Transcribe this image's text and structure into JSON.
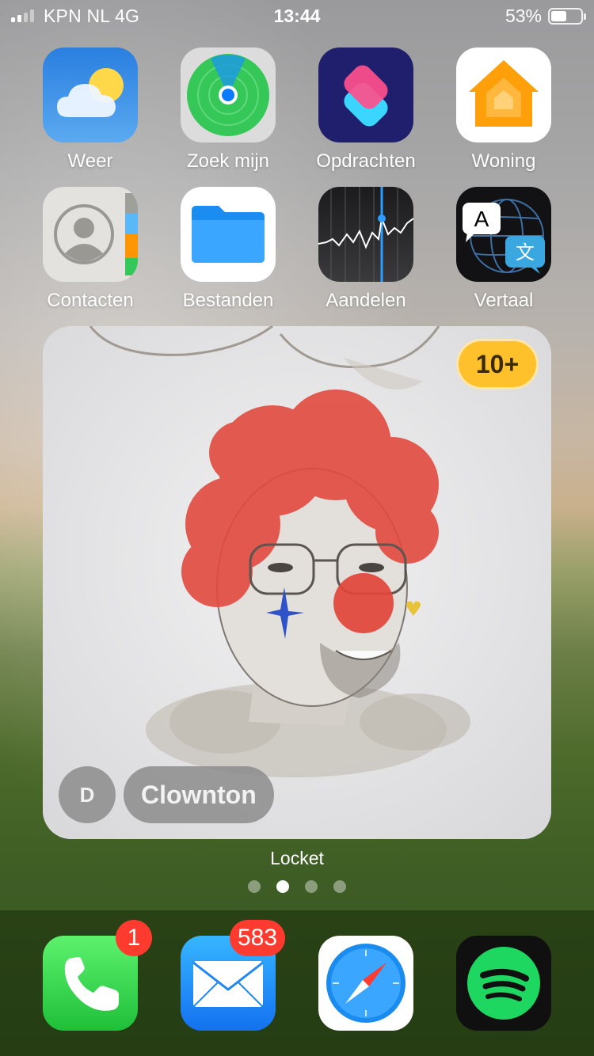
{
  "status_bar": {
    "carrier": "KPN NL   4G",
    "time": "13:44",
    "battery": "53%",
    "battery_level": 0.53,
    "signal_bars": 2
  },
  "apps": [
    {
      "label": "Weer",
      "icon": "weather-icon"
    },
    {
      "label": "Zoek mijn",
      "icon": "find-my-icon"
    },
    {
      "label": "Opdrachten",
      "icon": "shortcuts-icon"
    },
    {
      "label": "Woning",
      "icon": "home-icon"
    },
    {
      "label": "Contacten",
      "icon": "contacts-icon"
    },
    {
      "label": "Bestanden",
      "icon": "files-icon"
    },
    {
      "label": "Aandelen",
      "icon": "stocks-icon"
    },
    {
      "label": "Vertaal",
      "icon": "translate-icon"
    }
  ],
  "widget": {
    "label": "Locket",
    "count_badge": "10+",
    "sender_initial": "D",
    "caption": "Clownton",
    "photo": "clown-portrait-sketch"
  },
  "page_dots": {
    "count": 4,
    "active": 1
  },
  "dock": [
    {
      "app": "Phone",
      "icon": "phone-icon",
      "badge": "1"
    },
    {
      "app": "Mail",
      "icon": "mail-icon",
      "badge": "583"
    },
    {
      "app": "Safari",
      "icon": "safari-icon",
      "badge": ""
    },
    {
      "app": "Spotify",
      "icon": "spotify-icon",
      "badge": ""
    }
  ]
}
